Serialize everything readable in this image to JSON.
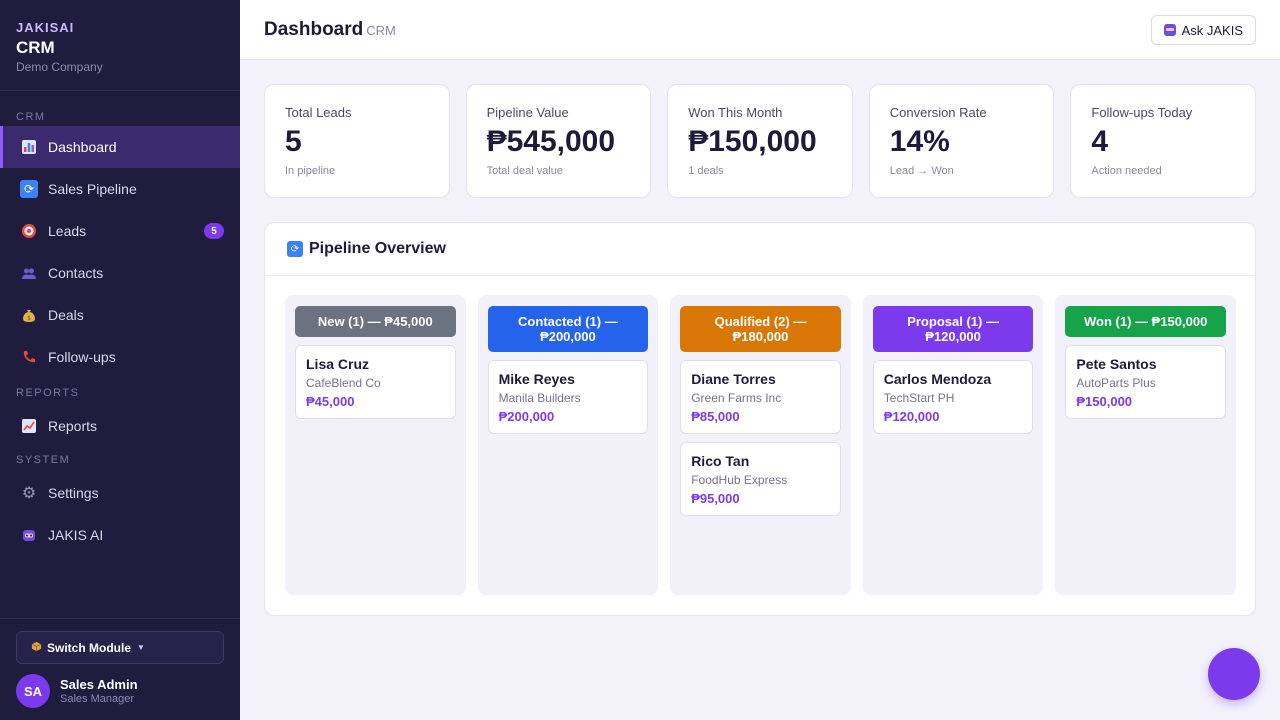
{
  "brand": {
    "kicker": "JAKISAI",
    "title": "CRM",
    "company": "Demo Company"
  },
  "nav": {
    "section_crm": "CRM",
    "section_reports": "REPORTS",
    "section_system": "SYSTEM",
    "items": [
      {
        "label": "Dashboard",
        "icon": "bar-chart-icon",
        "active": true
      },
      {
        "label": "Sales Pipeline",
        "icon": "refresh-icon"
      },
      {
        "label": "Leads",
        "icon": "target-icon",
        "badge": "5"
      },
      {
        "label": "Contacts",
        "icon": "people-icon"
      },
      {
        "label": "Deals",
        "icon": "money-bag-icon"
      },
      {
        "label": "Follow-ups",
        "icon": "phone-icon"
      },
      {
        "label": "Reports",
        "icon": "line-chart-icon"
      },
      {
        "label": "Settings",
        "icon": "gear-icon"
      },
      {
        "label": "JAKIS AI",
        "icon": "robot-icon"
      }
    ]
  },
  "switch_module": "Switch Module",
  "user": {
    "initials": "SA",
    "name": "Sales Admin",
    "role": "Sales Manager"
  },
  "header": {
    "title": "Dashboard",
    "subtitle": "CRM",
    "ask_label": "Ask JAKIS"
  },
  "stats": [
    {
      "label": "Total Leads",
      "value": "5",
      "note": "In pipeline"
    },
    {
      "label": "Pipeline Value",
      "value": "₱545,000",
      "note": "Total deal value"
    },
    {
      "label": "Won This Month",
      "value": "₱150,000",
      "note": "1 deals"
    },
    {
      "label": "Conversion Rate",
      "value": "14%",
      "note": "Lead → Won"
    },
    {
      "label": "Follow-ups Today",
      "value": "4",
      "note": "Action needed"
    }
  ],
  "pipeline": {
    "title": "Pipeline Overview",
    "columns": [
      {
        "header": "New (1) — ₱45,000",
        "color": "#6b7280",
        "deals": [
          {
            "name": "Lisa Cruz",
            "company": "CafeBlend Co",
            "amount": "₱45,000"
          }
        ]
      },
      {
        "header": "Contacted (1) — ₱200,000",
        "color": "#2563eb",
        "deals": [
          {
            "name": "Mike Reyes",
            "company": "Manila Builders",
            "amount": "₱200,000"
          }
        ]
      },
      {
        "header": "Qualified (2) — ₱180,000",
        "color": "#d97706",
        "deals": [
          {
            "name": "Diane Torres",
            "company": "Green Farms Inc",
            "amount": "₱85,000"
          },
          {
            "name": "Rico Tan",
            "company": "FoodHub Express",
            "amount": "₱95,000"
          }
        ]
      },
      {
        "header": "Proposal (1) — ₱120,000",
        "color": "#7c3aed",
        "deals": [
          {
            "name": "Carlos Mendoza",
            "company": "TechStart PH",
            "amount": "₱120,000"
          }
        ]
      },
      {
        "header": "Won (1) — ₱150,000",
        "color": "#16a34a",
        "deals": [
          {
            "name": "Pete Santos",
            "company": "AutoParts Plus",
            "amount": "₱150,000"
          }
        ]
      }
    ]
  },
  "colors": {
    "sidebar_bg": "#1f1c3d",
    "accent": "#7c3aed",
    "active_nav": "#3b2a6e"
  }
}
